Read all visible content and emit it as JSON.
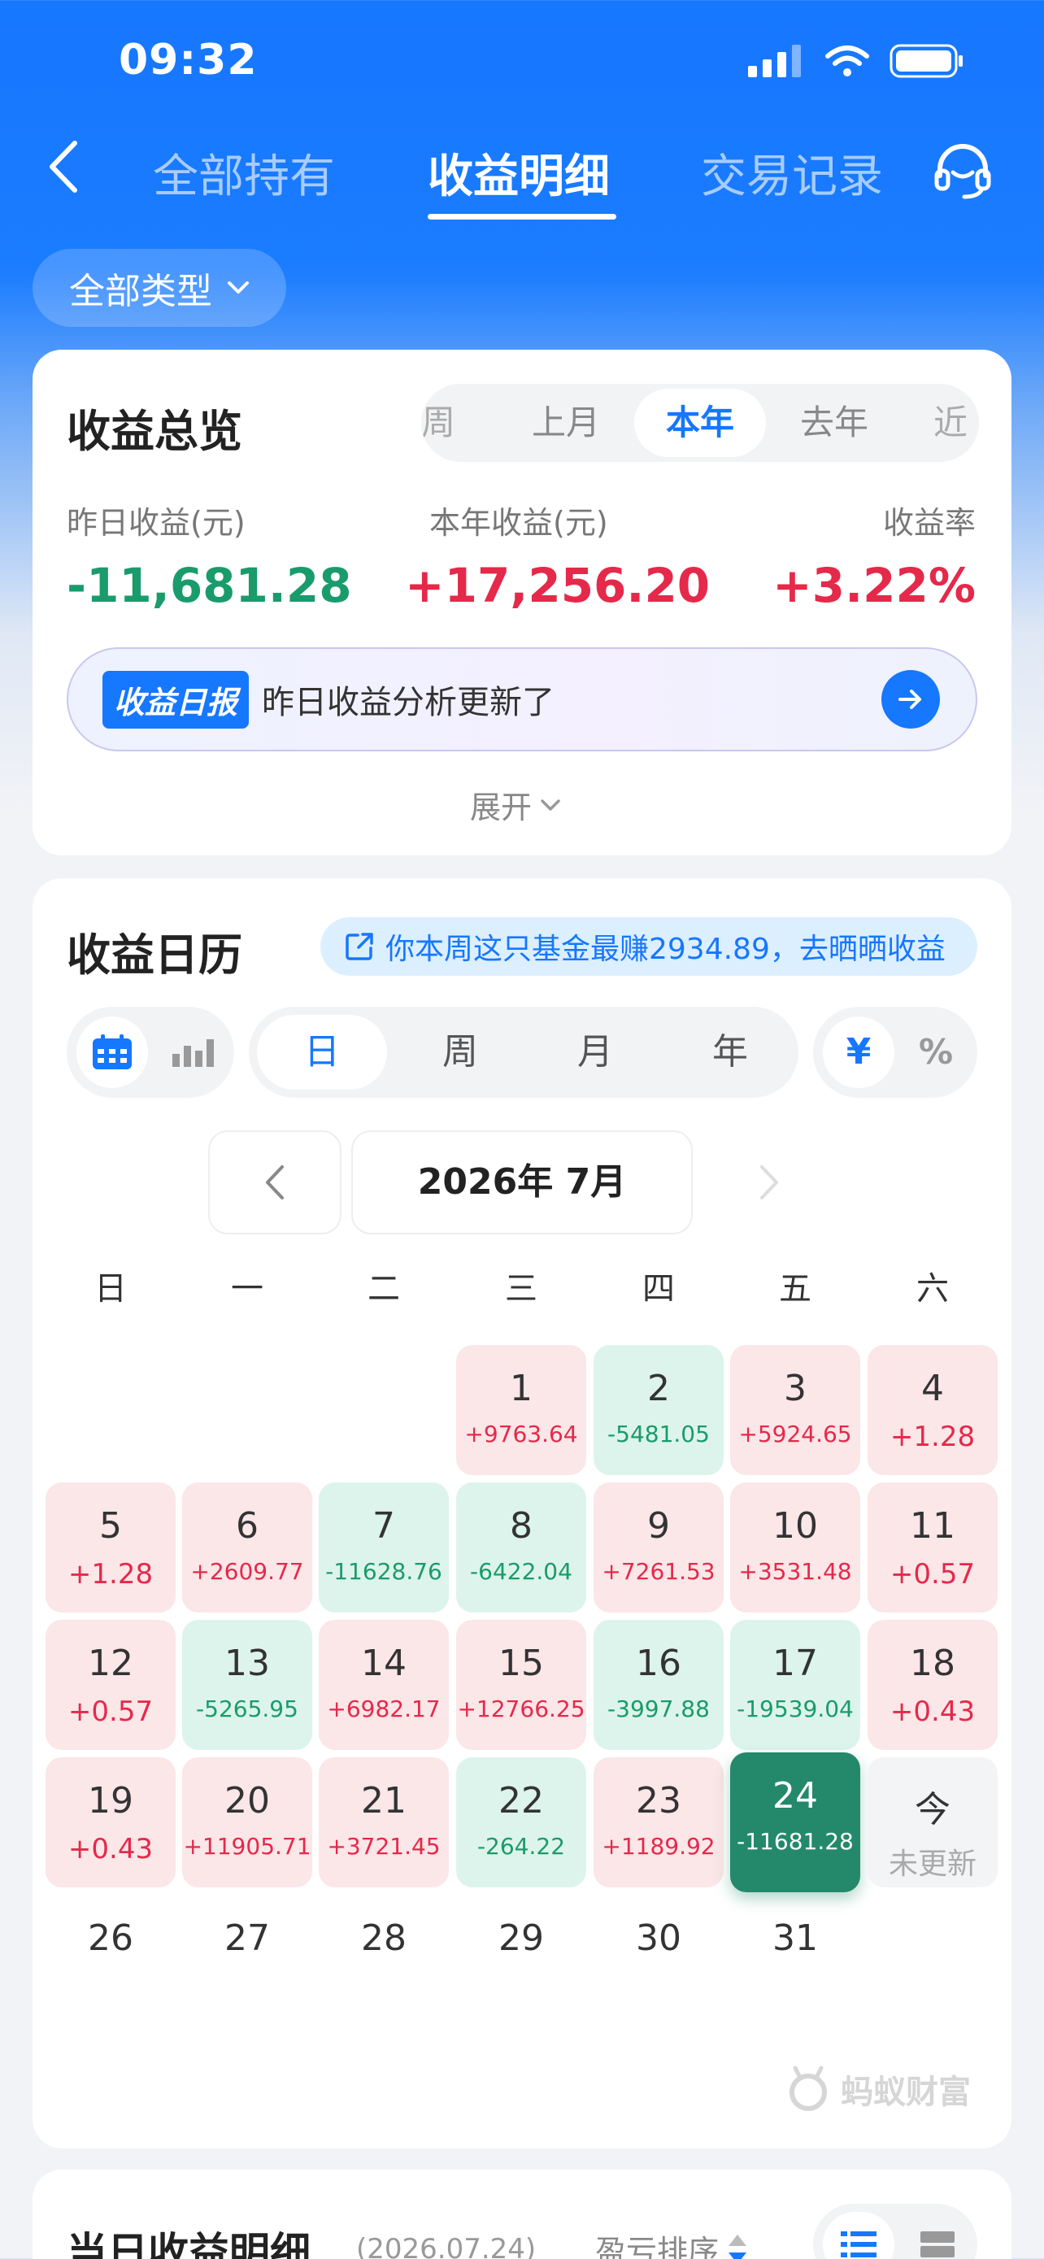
{
  "status_bar": {
    "time": "09:32"
  },
  "nav": {
    "tabs": [
      {
        "label": "全部持有"
      },
      {
        "label": "收益明细"
      },
      {
        "label": "交易记录"
      }
    ]
  },
  "filter": {
    "label": "全部类型"
  },
  "overview": {
    "title": "收益总览",
    "periods": [
      "周",
      "上月",
      "本年",
      "去年",
      "近一"
    ],
    "active_period": "本年",
    "yesterday": {
      "label": "昨日收益(元)",
      "value": "-11,681.28"
    },
    "year": {
      "label": "本年收益(元)",
      "value": "+17,256.20"
    },
    "rate": {
      "label": "收益率",
      "value": "+3.22%"
    },
    "report_tag": "收益日报",
    "report_text": "昨日收益分析更新了",
    "expand": "展开"
  },
  "calendar": {
    "title": "收益日历",
    "share_text": "你本周这只基金最赚2934.89，去晒晒收益",
    "granularity": [
      "日",
      "周",
      "月",
      "年"
    ],
    "unit_active": "¥",
    "unit_other": "%",
    "month_label": "2026年 7月",
    "weekdays": [
      "日",
      "一",
      "二",
      "三",
      "四",
      "五",
      "六"
    ],
    "days": [
      {
        "day": "1",
        "value": "+9763.64",
        "state": "pos"
      },
      {
        "day": "2",
        "value": "-5481.05",
        "state": "neg"
      },
      {
        "day": "3",
        "value": "+5924.65",
        "state": "pos"
      },
      {
        "day": "4",
        "value": "+1.28",
        "state": "pos"
      },
      {
        "day": "5",
        "value": "+1.28",
        "state": "pos"
      },
      {
        "day": "6",
        "value": "+2609.77",
        "state": "pos"
      },
      {
        "day": "7",
        "value": "-11628.76",
        "state": "neg"
      },
      {
        "day": "8",
        "value": "-6422.04",
        "state": "neg"
      },
      {
        "day": "9",
        "value": "+7261.53",
        "state": "pos"
      },
      {
        "day": "10",
        "value": "+3531.48",
        "state": "pos"
      },
      {
        "day": "11",
        "value": "+0.57",
        "state": "pos"
      },
      {
        "day": "12",
        "value": "+0.57",
        "state": "pos"
      },
      {
        "day": "13",
        "value": "-5265.95",
        "state": "neg"
      },
      {
        "day": "14",
        "value": "+6982.17",
        "state": "pos"
      },
      {
        "day": "15",
        "value": "+12766.25",
        "state": "pos"
      },
      {
        "day": "16",
        "value": "-3997.88",
        "state": "neg"
      },
      {
        "day": "17",
        "value": "-19539.04",
        "state": "neg"
      },
      {
        "day": "18",
        "value": "+0.43",
        "state": "pos"
      },
      {
        "day": "19",
        "value": "+0.43",
        "state": "pos"
      },
      {
        "day": "20",
        "value": "+11905.71",
        "state": "pos"
      },
      {
        "day": "21",
        "value": "+3721.45",
        "state": "pos"
      },
      {
        "day": "22",
        "value": "-264.22",
        "state": "neg"
      },
      {
        "day": "23",
        "value": "+1189.92",
        "state": "pos"
      },
      {
        "day": "24",
        "value": "-11681.28",
        "state": "sel"
      },
      {
        "day": "今",
        "value": "未更新",
        "state": "today"
      },
      {
        "day": "26",
        "value": "",
        "state": "future"
      },
      {
        "day": "27",
        "value": "",
        "state": "future"
      },
      {
        "day": "28",
        "value": "",
        "state": "future"
      },
      {
        "day": "29",
        "value": "",
        "state": "future"
      },
      {
        "day": "30",
        "value": "",
        "state": "future"
      },
      {
        "day": "31",
        "value": "",
        "state": "future"
      }
    ],
    "watermark": "蚂蚁财富"
  },
  "daily_detail": {
    "title": "当日收益明细",
    "date": "(2026.07.24)",
    "sort_label": "盈亏排序"
  },
  "colors": {
    "accent": "#1677ff",
    "gain": "#e5294a",
    "loss": "#1a9b6c",
    "selected": "#24896a"
  }
}
